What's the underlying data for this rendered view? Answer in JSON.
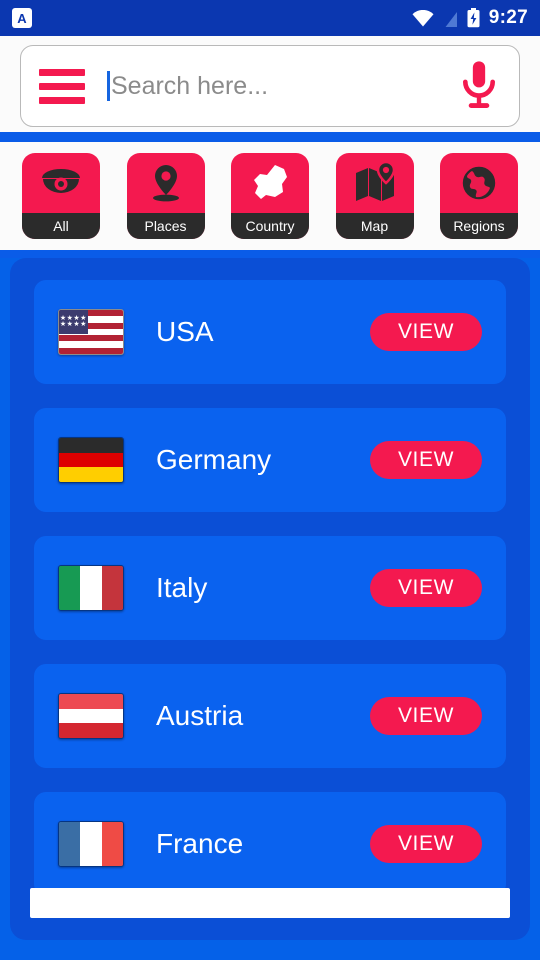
{
  "status_bar": {
    "notification_icon": "app-notification-icon",
    "notification_letter": "A",
    "wifi_icon": "wifi-icon",
    "signal_icon": "no-signal-icon",
    "battery_icon": "battery-charging-icon",
    "clock": "9:27",
    "background_color": "#0b37b0"
  },
  "search": {
    "menu_icon": "hamburger-menu-icon",
    "placeholder": "Search here...",
    "value": "",
    "mic_icon": "microphone-icon",
    "accent_color": "#f4194f"
  },
  "categories": [
    {
      "label": "All",
      "icon": "security-camera-icon"
    },
    {
      "label": "Places",
      "icon": "location-pin-icon"
    },
    {
      "label": "Country",
      "icon": "country-map-shape-icon"
    },
    {
      "label": "Map",
      "icon": "folded-map-pin-icon"
    },
    {
      "label": "Regions",
      "icon": "globe-icon"
    }
  ],
  "list": {
    "action_label": "VIEW",
    "items": [
      {
        "name": "USA",
        "flag": "flag-usa"
      },
      {
        "name": "Germany",
        "flag": "flag-germany"
      },
      {
        "name": "Italy",
        "flag": "flag-italy"
      },
      {
        "name": "Austria",
        "flag": "flag-austria"
      },
      {
        "name": "France",
        "flag": "flag-france"
      }
    ]
  },
  "bottom_banner": {
    "name": "bottom-banner",
    "text": ""
  },
  "colors": {
    "page_background": "#0561e8",
    "panel_background": "#0b4fd6",
    "row_background": "#0a62ef",
    "accent": "#f4194f",
    "status_bar": "#0b37b0"
  }
}
